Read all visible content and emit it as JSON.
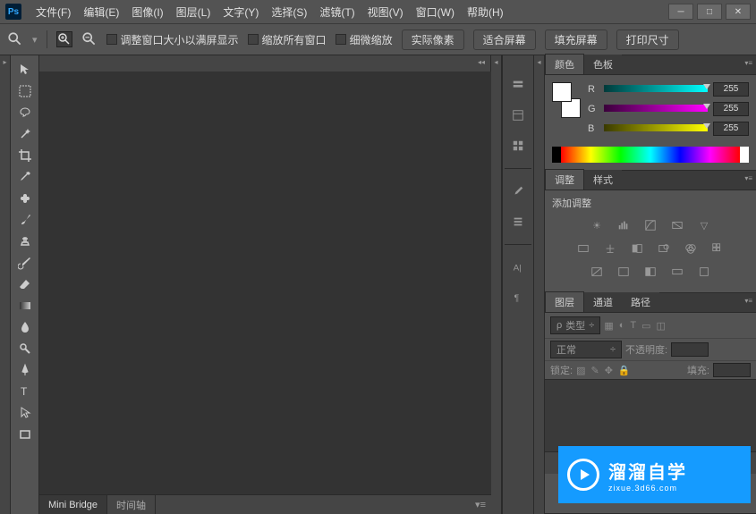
{
  "menu": {
    "file": "文件(F)",
    "edit": "编辑(E)",
    "image": "图像(I)",
    "layer": "图层(L)",
    "type": "文字(Y)",
    "select": "选择(S)",
    "filter": "滤镜(T)",
    "view": "视图(V)",
    "window": "窗口(W)",
    "help": "帮助(H)"
  },
  "options": {
    "resize_fit": "调整窗口大小以满屏显示",
    "zoom_all": "缩放所有窗口",
    "scrubby": "细微缩放",
    "actual": "实际像素",
    "fit": "适合屏幕",
    "fill": "填充屏幕",
    "print": "打印尺寸"
  },
  "bottom_tabs": {
    "mini_bridge": "Mini Bridge",
    "timeline": "时间轴"
  },
  "color_panel": {
    "tab_color": "颜色",
    "tab_swatches": "色板",
    "r": "R",
    "g": "G",
    "b": "B",
    "r_val": "255",
    "g_val": "255",
    "b_val": "255"
  },
  "adjust_panel": {
    "tab_adjust": "调整",
    "tab_styles": "样式",
    "title": "添加调整"
  },
  "layers_panel": {
    "tab_layers": "图层",
    "tab_channels": "通道",
    "tab_paths": "路径",
    "kind": "类型",
    "blend": "正常",
    "opacity_label": "不透明度:",
    "lock_label": "锁定:",
    "fill_label": "填充:"
  },
  "watermark": {
    "main": "溜溜自学",
    "sub": "zixue.3d66.com"
  }
}
